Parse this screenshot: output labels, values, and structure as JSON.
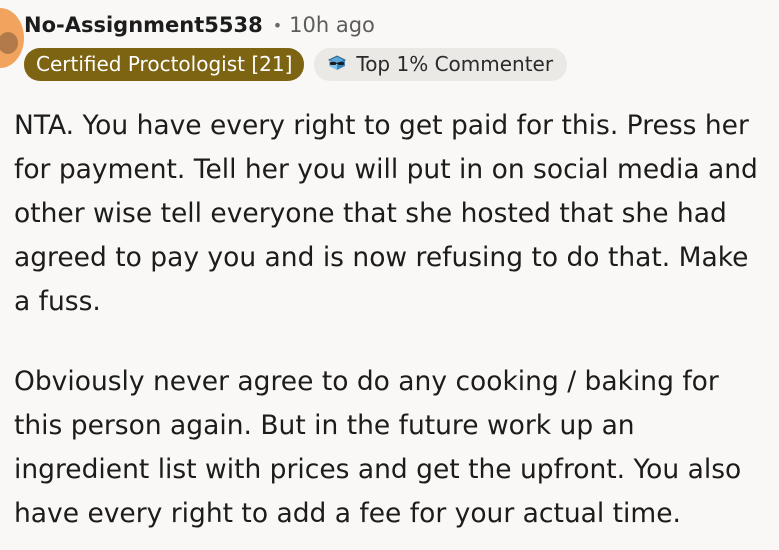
{
  "comment": {
    "author": "No-Assignment5538",
    "separator": "•",
    "time": "10h ago",
    "flair": "Certified Proctologist [21]",
    "achievement": {
      "icon": "sunglasses-badge-icon",
      "label": "Top 1% Commenter"
    },
    "paragraphs": [
      "NTA. You have every right to get paid for this. Press her for payment. Tell her you will put in on social media and other wise tell everyone that she hosted that she had agreed to pay you and is now refusing to do that. Make a fuss.",
      "Obviously never agree to do any cooking / baking for this person again. But in the future work up an ingredient list with prices and get the upfront. You also have every right to add a fee for your actual time."
    ]
  },
  "colors": {
    "background": "#f9f8f6",
    "flair_bg": "#7d6412",
    "badge_bg": "#ebe9e6",
    "avatar": "#f2a35e"
  }
}
